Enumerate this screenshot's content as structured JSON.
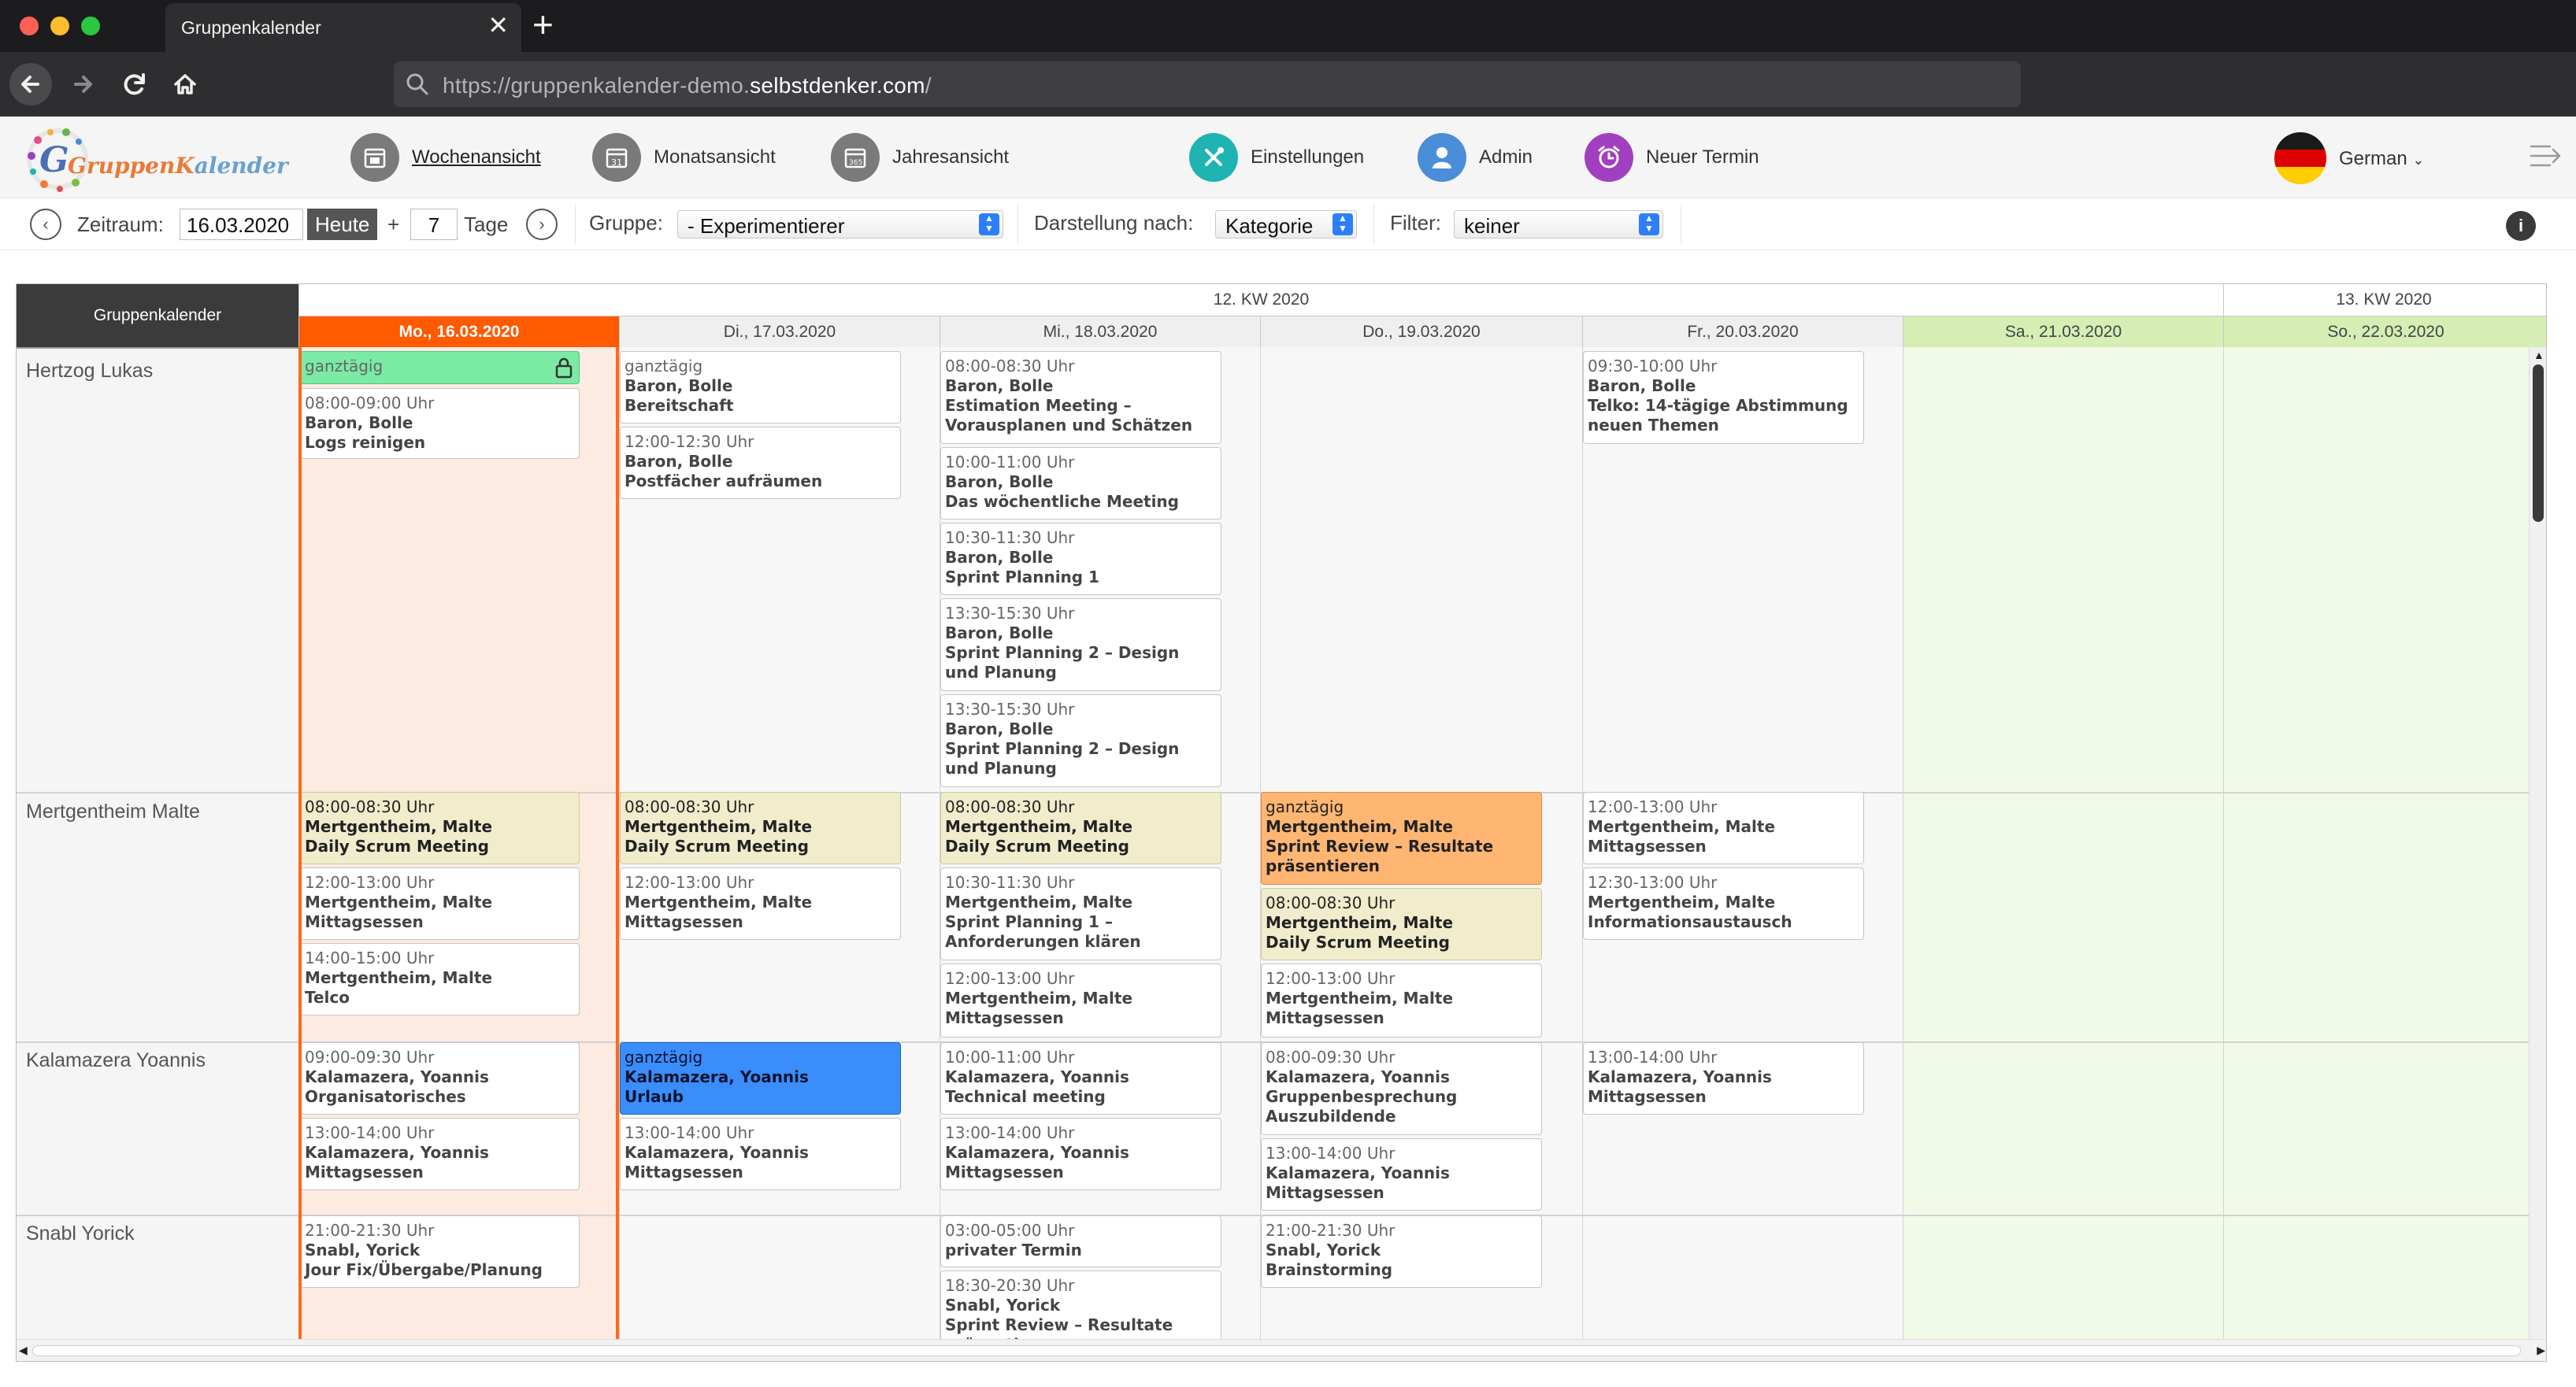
{
  "browser": {
    "tab_title": "Gruppenkalender",
    "tab_close": "✕",
    "new_tab": "+",
    "url_prefix": "https://gruppenkalender-demo.",
    "url_host": "selbstdenker.com",
    "url_suffix": "/"
  },
  "app": {
    "logo_part1": "GruppenK",
    "logo_part2": "alender",
    "nav": {
      "week": "Wochenansicht",
      "month": "Monatsansicht",
      "year": "Jahresansicht",
      "settings": "Einstellungen",
      "admin": "Admin",
      "new_event": "Neuer Termin"
    },
    "language": "German",
    "colors": {
      "accent_today": "#ff5a00",
      "weekend": "#d4eeb4"
    }
  },
  "toolbar": {
    "zeitraum_label": "Zeitraum:",
    "date_value": "16.03.2020",
    "today_button": "Heute",
    "plus": "+",
    "days_value": "7",
    "days_label": "Tage",
    "gruppe_label": "Gruppe:",
    "gruppe_value": "- Experimentierer",
    "darstellung_label": "Darstellung nach:",
    "darstellung_value": "Kategorie",
    "filter_label": "Filter:",
    "filter_value": "keiner",
    "info": "i"
  },
  "calendar": {
    "corner_label": "Gruppenkalender",
    "kw": [
      "12. KW 2020",
      "13. KW 2020"
    ],
    "days": [
      "Mo., 16.03.2020",
      "Di., 17.03.2020",
      "Mi., 18.03.2020",
      "Do., 19.03.2020",
      "Fr., 20.03.2020",
      "Sa., 21.03.2020",
      "So., 22.03.2020"
    ],
    "people": [
      "Hertzog Lukas",
      "Mertgentheim Malte",
      "Kalamazera Yoannis",
      "Snabl Yorick"
    ],
    "events": [
      {
        "time": "ganztägig",
        "person": "",
        "subject": ""
      },
      {
        "time": "08:00-09:00 Uhr",
        "person": "Baron, Bolle",
        "subject": "Logs reinigen"
      },
      {
        "time": "ganztägig",
        "person": "Baron, Bolle",
        "subject": "Bereitschaft"
      },
      {
        "time": "12:00-12:30 Uhr",
        "person": "Baron, Bolle",
        "subject": "Postfächer aufräumen"
      },
      {
        "time": "08:00-08:30 Uhr",
        "person": "Baron, Bolle",
        "subject": "Estimation Meeting – Vorausplanen und Schätzen"
      },
      {
        "time": "10:00-11:00 Uhr",
        "person": "Baron, Bolle",
        "subject": "Das wöchentliche Meeting"
      },
      {
        "time": "10:30-11:30 Uhr",
        "person": "Baron, Bolle",
        "subject": "Sprint Planning 1"
      },
      {
        "time": "13:30-15:30 Uhr",
        "person": "Baron, Bolle",
        "subject": "Sprint Planning 2 – Design und Planung"
      },
      {
        "time": "13:30-15:30 Uhr",
        "person": "Baron, Bolle",
        "subject": "Sprint Planning 2 – Design und Planung"
      },
      {
        "time": "09:30-10:00 Uhr",
        "person": "Baron, Bolle",
        "subject": "Telko: 14-tägige Abstimmung neuen Themen"
      },
      {
        "time": "08:00-08:30 Uhr",
        "person": "Mertgentheim, Malte",
        "subject": "Daily Scrum Meeting"
      },
      {
        "time": "12:00-13:00 Uhr",
        "person": "Mertgentheim, Malte",
        "subject": "Mittagsessen"
      },
      {
        "time": "14:00-15:00 Uhr",
        "person": "Mertgentheim, Malte",
        "subject": "Telco"
      },
      {
        "time": "08:00-08:30 Uhr",
        "person": "Mertgentheim, Malte",
        "subject": "Daily Scrum Meeting"
      },
      {
        "time": "12:00-13:00 Uhr",
        "person": "Mertgentheim, Malte",
        "subject": "Mittagsessen"
      },
      {
        "time": "08:00-08:30 Uhr",
        "person": "Mertgentheim, Malte",
        "subject": "Daily Scrum Meeting"
      },
      {
        "time": "10:30-11:30 Uhr",
        "person": "Mertgentheim, Malte",
        "subject": "Sprint Planning 1 – Anforderungen klären"
      },
      {
        "time": "12:00-13:00 Uhr",
        "person": "Mertgentheim, Malte",
        "subject": "Mittagsessen"
      },
      {
        "time": "ganztägig",
        "person": "Mertgentheim, Malte",
        "subject": "Sprint Review – Resultate präsentieren"
      },
      {
        "time": "08:00-08:30 Uhr",
        "person": "Mertgentheim, Malte",
        "subject": "Daily Scrum Meeting"
      },
      {
        "time": "12:00-13:00 Uhr",
        "person": "Mertgentheim, Malte",
        "subject": "Mittagsessen"
      },
      {
        "time": "12:00-13:00 Uhr",
        "person": "Mertgentheim, Malte",
        "subject": "Mittagsessen"
      },
      {
        "time": "12:30-13:00 Uhr",
        "person": "Mertgentheim, Malte",
        "subject": "Informationsaustausch"
      },
      {
        "time": "09:00-09:30 Uhr",
        "person": "Kalamazera, Yoannis",
        "subject": "Organisatorisches"
      },
      {
        "time": "13:00-14:00 Uhr",
        "person": "Kalamazera, Yoannis",
        "subject": "Mittagsessen"
      },
      {
        "time": "ganztägig",
        "person": "Kalamazera, Yoannis",
        "subject": "Urlaub"
      },
      {
        "time": "13:00-14:00 Uhr",
        "person": "Kalamazera, Yoannis",
        "subject": "Mittagsessen"
      },
      {
        "time": "10:00-11:00 Uhr",
        "person": "Kalamazera, Yoannis",
        "subject": "Technical meeting"
      },
      {
        "time": "13:00-14:00 Uhr",
        "person": "Kalamazera, Yoannis",
        "subject": "Mittagsessen"
      },
      {
        "time": "08:00-09:30 Uhr",
        "person": "Kalamazera, Yoannis",
        "subject": "Gruppenbesprechung Auszubildende"
      },
      {
        "time": "13:00-14:00 Uhr",
        "person": "Kalamazera, Yoannis",
        "subject": "Mittagsessen"
      },
      {
        "time": "13:00-14:00 Uhr",
        "person": "Kalamazera, Yoannis",
        "subject": "Mittagsessen"
      },
      {
        "time": "21:00-21:30 Uhr",
        "person": "Snabl, Yorick",
        "subject": "Jour Fix/Übergabe/Planung"
      },
      {
        "time": "03:00-05:00 Uhr",
        "person": "privater Termin",
        "subject": ""
      },
      {
        "time": "18:30-20:30 Uhr",
        "person": "Snabl, Yorick",
        "subject": "Sprint Review – Resultate präsentieren"
      },
      {
        "time": "21:00-21:30 Uhr",
        "person": "Snabl, Yorick",
        "subject": "Brainstorming"
      }
    ]
  }
}
